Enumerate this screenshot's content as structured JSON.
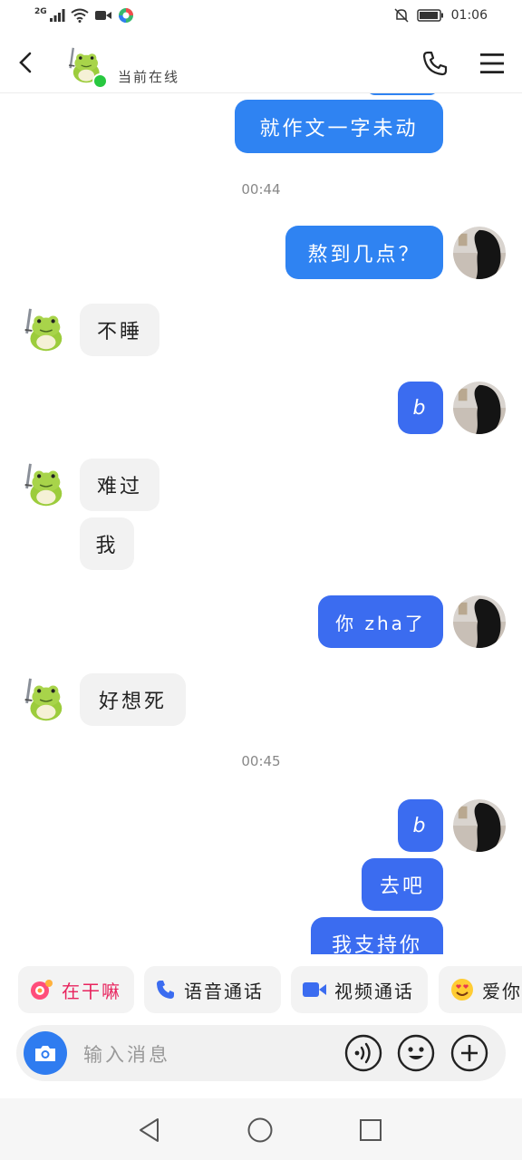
{
  "status_bar": {
    "network": "2G",
    "time": "01:06"
  },
  "header": {
    "contact_status": "当前在线",
    "online": true
  },
  "messages": [
    {
      "text": "就作文一字未动"
    },
    {
      "text": "00:44"
    },
    {
      "text": "熬到几点？"
    },
    {
      "text": "不睡"
    },
    {
      "text": "b"
    },
    {
      "text": "难过"
    },
    {
      "text": "我"
    },
    {
      "text": "你 zha了"
    },
    {
      "text": "好想死"
    },
    {
      "text": "00:45"
    },
    {
      "text": "b"
    },
    {
      "text": "去吧"
    },
    {
      "text": "我支持你"
    }
  ],
  "quick_actions": [
    {
      "label": "在干嘛",
      "icon": "swirl-icon"
    },
    {
      "label": "语音通话",
      "icon": "phone-icon"
    },
    {
      "label": "视频通话",
      "icon": "video-icon"
    },
    {
      "label": "爱你",
      "icon": "heart-eyes-emoji-icon"
    }
  ],
  "input": {
    "placeholder": "输入消息"
  },
  "colors": {
    "outgoing": "#2f83f2",
    "incoming": "#f2f2f2",
    "online": "#28c840",
    "accent": "#2f7cf0"
  }
}
